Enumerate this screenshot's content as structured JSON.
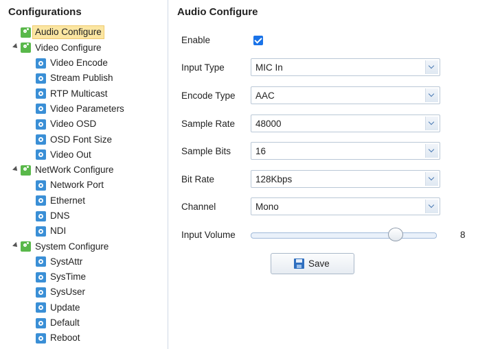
{
  "sidebar": {
    "title": "Configurations",
    "tree": [
      {
        "label": "Audio Configure",
        "level": 0,
        "icon": "config-gear-icon",
        "selected": true
      },
      {
        "label": "Video Configure",
        "level": 0,
        "icon": "config-gear-icon",
        "expanded": true
      },
      {
        "label": "Video Encode",
        "level": 1,
        "icon": "settings-gear-icon"
      },
      {
        "label": "Stream Publish",
        "level": 1,
        "icon": "settings-gear-icon"
      },
      {
        "label": "RTP Multicast",
        "level": 1,
        "icon": "settings-gear-icon"
      },
      {
        "label": "Video Parameters",
        "level": 1,
        "icon": "settings-gear-icon"
      },
      {
        "label": "Video OSD",
        "level": 1,
        "icon": "settings-gear-icon"
      },
      {
        "label": "OSD Font Size",
        "level": 1,
        "icon": "settings-gear-icon"
      },
      {
        "label": "Video Out",
        "level": 1,
        "icon": "settings-gear-icon"
      },
      {
        "label": "NetWork Configure",
        "level": 0,
        "icon": "config-gear-icon",
        "expanded": true
      },
      {
        "label": "Network Port",
        "level": 1,
        "icon": "settings-gear-icon"
      },
      {
        "label": "Ethernet",
        "level": 1,
        "icon": "settings-gear-icon"
      },
      {
        "label": "DNS",
        "level": 1,
        "icon": "settings-gear-icon"
      },
      {
        "label": "NDI",
        "level": 1,
        "icon": "settings-gear-icon"
      },
      {
        "label": "System Configure",
        "level": 0,
        "icon": "config-gear-icon",
        "expanded": true
      },
      {
        "label": "SystAttr",
        "level": 1,
        "icon": "settings-gear-icon"
      },
      {
        "label": "SysTime",
        "level": 1,
        "icon": "settings-gear-icon"
      },
      {
        "label": "SysUser",
        "level": 1,
        "icon": "settings-gear-icon"
      },
      {
        "label": "Update",
        "level": 1,
        "icon": "settings-gear-icon"
      },
      {
        "label": "Default",
        "level": 1,
        "icon": "settings-gear-icon"
      },
      {
        "label": "Reboot",
        "level": 1,
        "icon": "settings-gear-icon"
      }
    ]
  },
  "main": {
    "title": "Audio Configure",
    "enable": {
      "label": "Enable",
      "checked": true
    },
    "input_type": {
      "label": "Input Type",
      "value": "MIC In"
    },
    "encode_type": {
      "label": "Encode Type",
      "value": "AAC"
    },
    "sample_rate": {
      "label": "Sample Rate",
      "value": "48000"
    },
    "sample_bits": {
      "label": "Sample Bits",
      "value": "16"
    },
    "bit_rate": {
      "label": "Bit Rate",
      "value": "128Kbps"
    },
    "channel": {
      "label": "Channel",
      "value": "Mono"
    },
    "input_volume": {
      "label": "Input Volume",
      "value": "8"
    },
    "save_label": "Save"
  },
  "colors": {
    "selected_bg": "#fbe6a2",
    "checkbox": "#1a73e8",
    "config_icon": "#59b84a",
    "sub_icon": "#3a8fd6"
  }
}
